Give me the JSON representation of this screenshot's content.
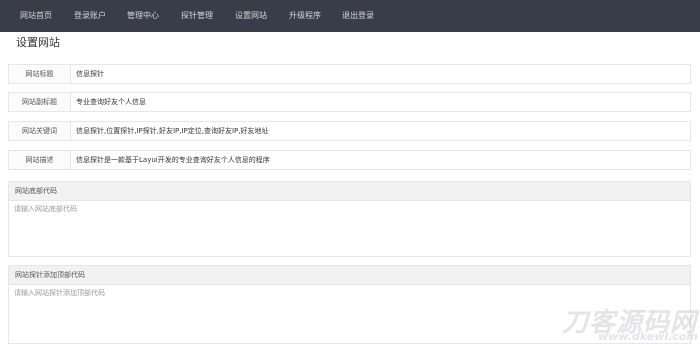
{
  "nav": {
    "items": [
      "网站首页",
      "登录账户",
      "管理中心",
      "探针管理",
      "设置网站",
      "升级程序",
      "退出登录"
    ]
  },
  "page": {
    "title": "设置网站"
  },
  "fields": [
    {
      "label": "网站标题",
      "value": "信息探针"
    },
    {
      "label": "网站副标题",
      "value": "专业查询好友个人信息"
    },
    {
      "label": "网站关键词",
      "value": "信息探针,位置探针,IP探针,好友IP,IP定位,查询好友IP,好友地址"
    },
    {
      "label": "网站描述",
      "value": "信息探针是一款基于Layui开发的专业查询好友个人信息的程序"
    }
  ],
  "footer_code": {
    "label": "网站底部代码",
    "placeholder": "请输入网站底部代码"
  },
  "probe_code": {
    "label": "网站探针添加顶部代码",
    "placeholder": "请输入网站探针添加顶部代码"
  },
  "watermark": {
    "text": "刀客源码网",
    "url": "www.dkewl.com"
  },
  "colors": {
    "nav_bg": "#393d49",
    "nav_text": "#d6d6d6",
    "border": "#e6e6e6",
    "label_bg": "#fbfbfb",
    "header_bg": "#f2f2f2"
  }
}
